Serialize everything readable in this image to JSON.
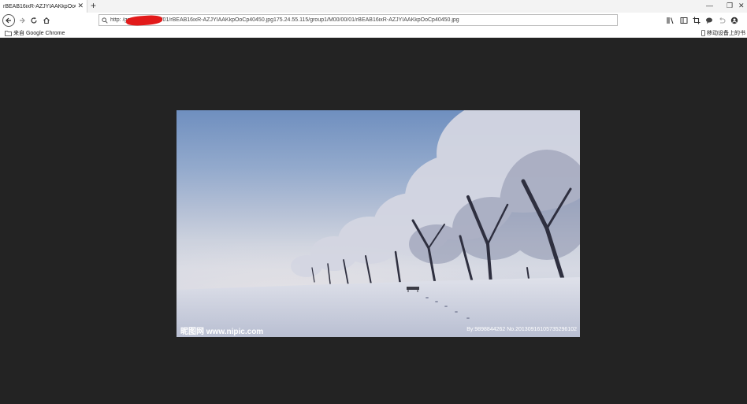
{
  "tab": {
    "title": "rBEAB16ixR-AZJYIAAKkpOoCp40",
    "close": "✕"
  },
  "new_tab": "+",
  "window_controls": {
    "minimize": "—",
    "restore": "❐",
    "close": "✕"
  },
  "address_bar": {
    "url": "http:                    /group1/M00/00/01/rBEAB16ixR-AZJYIAAKkpOoCp40450.jpg175.24.55.115/group1/M00/00/01/rBEAB16ixR-AZJYIAAKkpOoCp40450.jpg"
  },
  "bookmarks": {
    "left": "来自 Google Chrome",
    "right": "移动设备上的书"
  },
  "image": {
    "watermark_left": "昵图网 www.nipic.com",
    "watermark_right": "By:9898844262  No.20130916105735296102"
  },
  "colors": {
    "background": "#232323",
    "redaction": "#e21a1a"
  }
}
